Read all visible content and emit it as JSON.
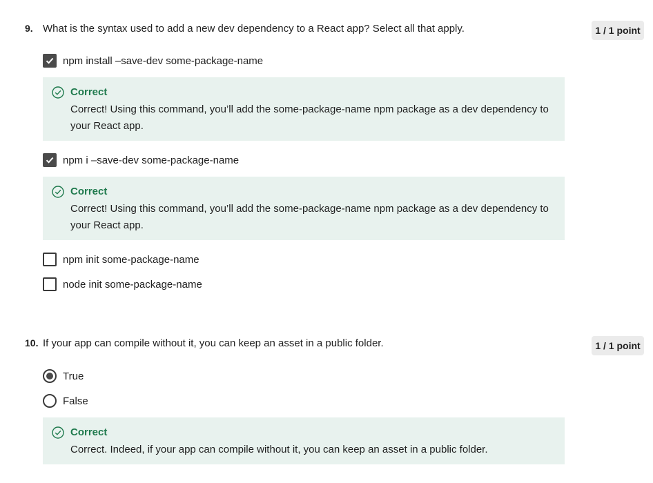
{
  "q9": {
    "number": "9.",
    "text": "What is the syntax used to add a new dev dependency to a React app? Select all that apply.",
    "points": "1 / 1 point",
    "options": [
      {
        "label": "npm install –save-dev some-package-name",
        "checked": true
      },
      {
        "label": "npm i –save-dev some-package-name",
        "checked": true
      },
      {
        "label": "npm init some-package-name",
        "checked": false
      },
      {
        "label": "node init some-package-name",
        "checked": false
      }
    ],
    "feedback": [
      {
        "title": "Correct",
        "body": "Correct! Using this command, you’ll add the some-package-name npm package as a dev dependency to your React app."
      },
      {
        "title": "Correct",
        "body": "Correct! Using this command, you’ll add the some-package-name npm package as a dev dependency to your React app."
      }
    ]
  },
  "q10": {
    "number": "10.",
    "text": "If your app can compile without it, you can keep an asset in a public folder.",
    "points": "1 / 1 point",
    "options": [
      {
        "label": "True",
        "selected": true
      },
      {
        "label": "False",
        "selected": false
      }
    ],
    "feedback": {
      "title": "Correct",
      "body": "Correct. Indeed, if your app can compile without it, you can keep an asset in a public folder."
    }
  },
  "colors": {
    "feedback_bg": "#e8f2ee",
    "correct_green": "#1f7a4d",
    "control_dark": "#4a4a4a",
    "points_bg": "#ebebeb"
  },
  "icons": {
    "checkmark": "check-icon",
    "correct": "correct-circle-check-icon"
  }
}
